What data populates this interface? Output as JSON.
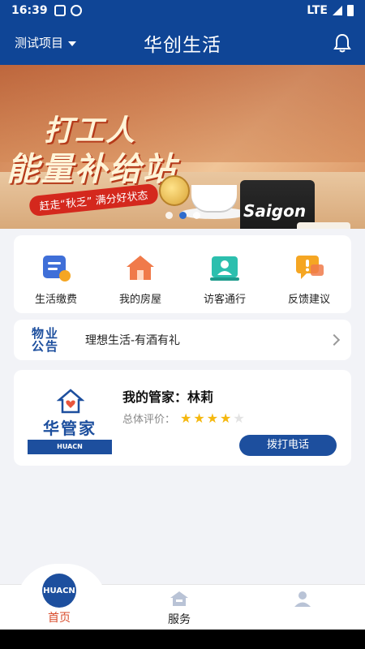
{
  "status_bar": {
    "time": "16:39",
    "network": "LTE"
  },
  "header": {
    "project": "测试项目",
    "title": "华创生活"
  },
  "banner": {
    "line1": "打工人",
    "line2": "能量补给站",
    "tagline": "赶走“秋乏” 满分好状态",
    "brand": "Saigon",
    "dots": 3,
    "active_dot": 1
  },
  "quick_menu": [
    {
      "label": "生活缴费",
      "icon": "bill-icon"
    },
    {
      "label": "我的房屋",
      "icon": "house-icon"
    },
    {
      "label": "访客通行",
      "icon": "visitor-icon"
    },
    {
      "label": "反馈建议",
      "icon": "feedback-icon"
    }
  ],
  "notice": {
    "badge_line1": "物业",
    "badge_line2": "公告",
    "text": "理想生活-有酒有礼"
  },
  "butler": {
    "logo_text": "华管家",
    "logo_strip": "HUACN",
    "name": "我的管家：林莉",
    "rating_label": "总体评价：",
    "rating": 4,
    "rating_max": 5,
    "call_label": "拨打电话"
  },
  "tabs": {
    "home": "首页",
    "home_logo": "HUACN",
    "service": "服务"
  },
  "colors": {
    "brand": "#0f4596",
    "accent": "#d84c2c",
    "star": "#f5b80f"
  }
}
